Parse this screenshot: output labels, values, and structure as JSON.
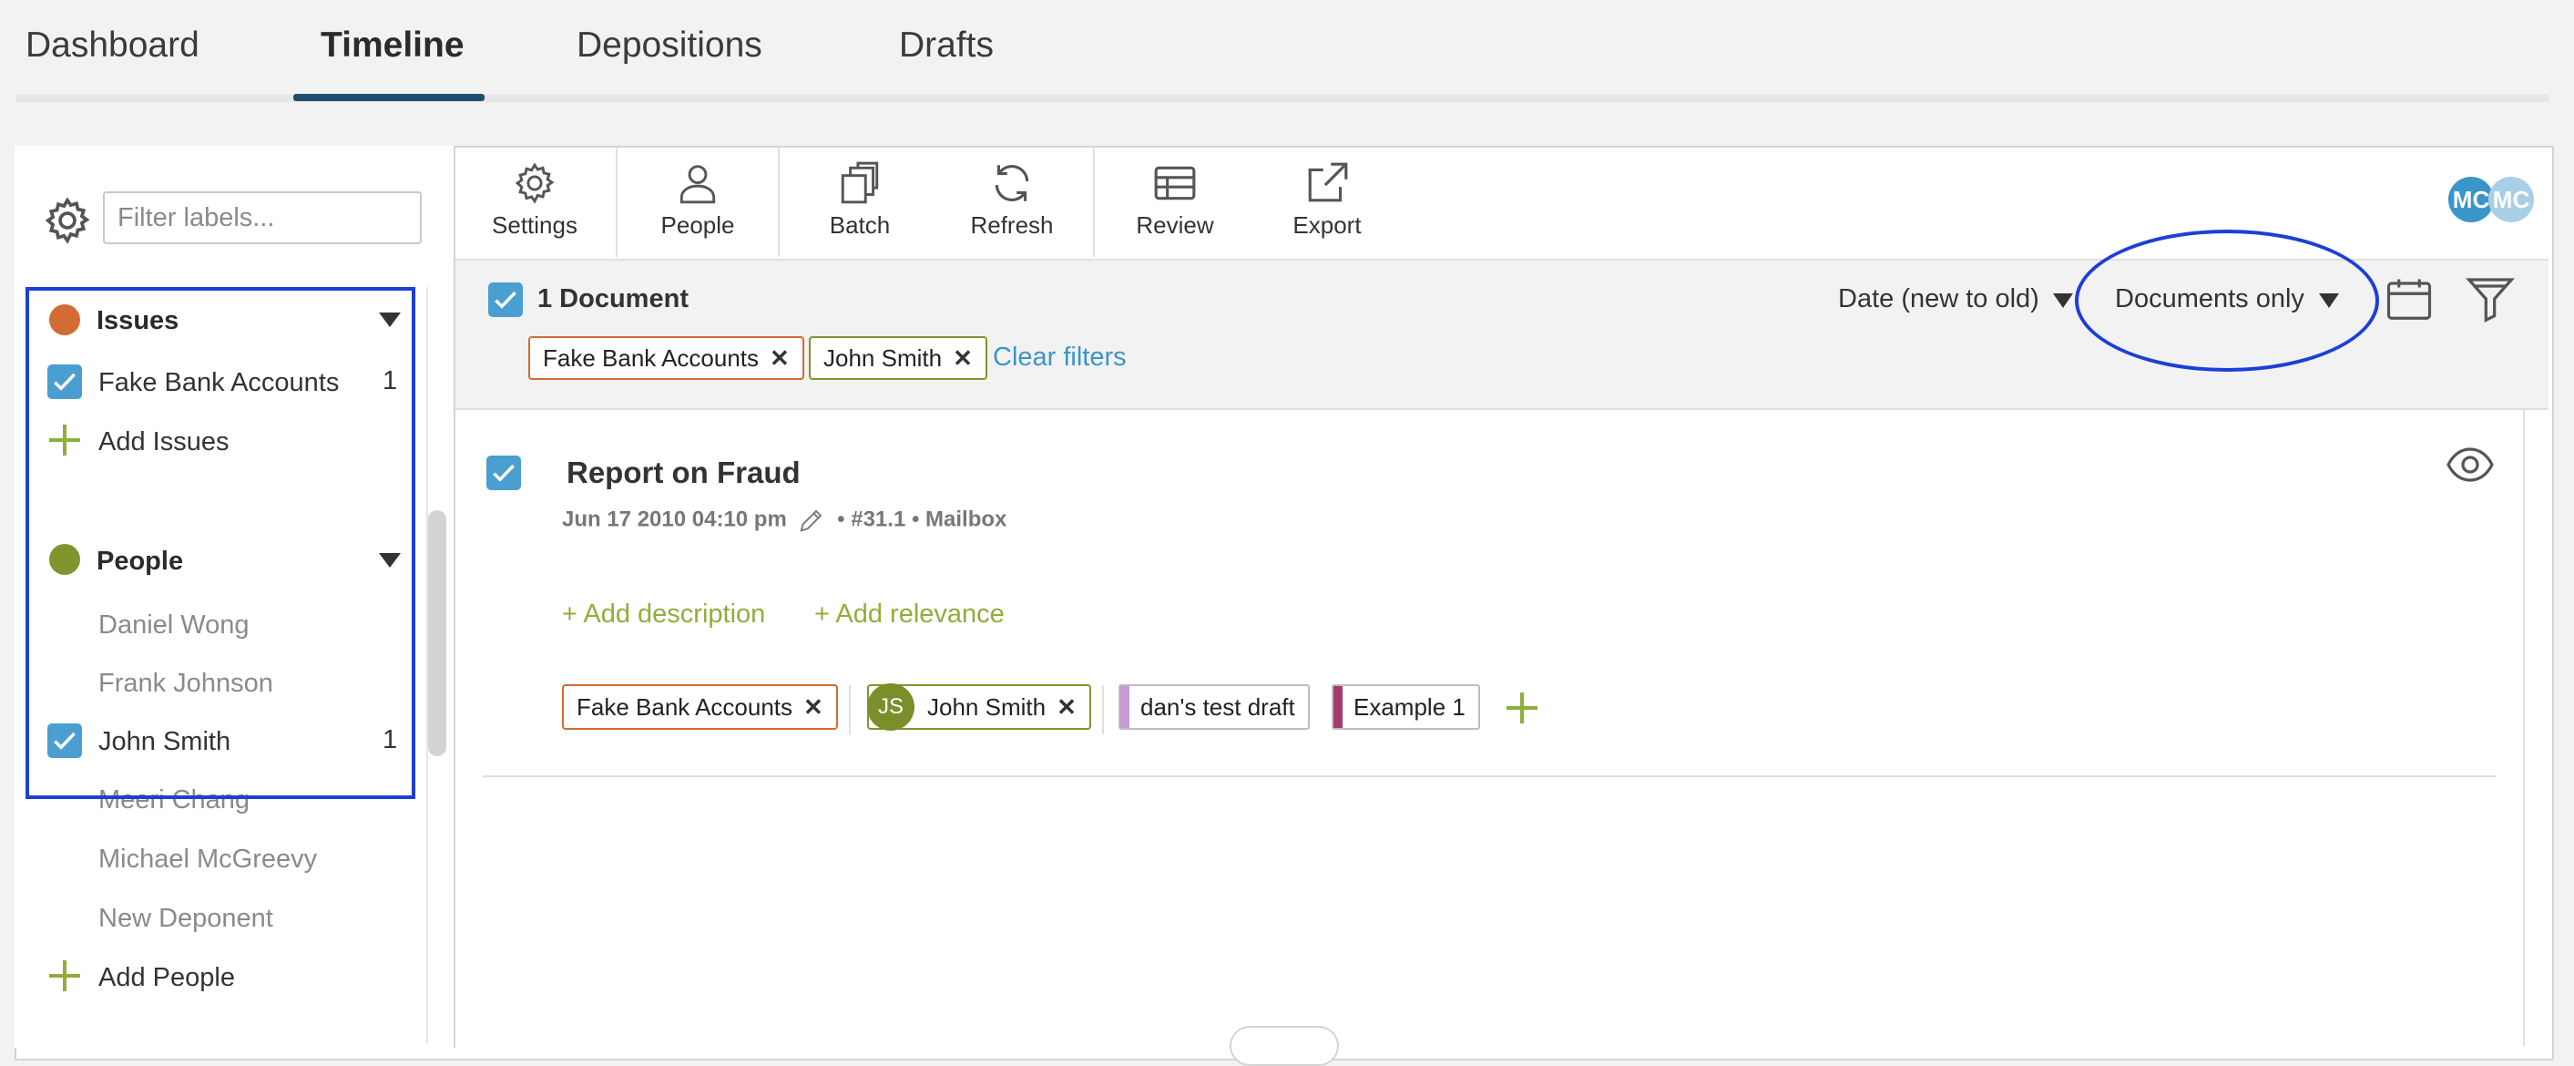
{
  "nav": {
    "tabs": [
      {
        "label": "Dashboard",
        "active": false
      },
      {
        "label": "Timeline",
        "active": true
      },
      {
        "label": "Depositions",
        "active": false
      },
      {
        "label": "Drafts",
        "active": false
      }
    ]
  },
  "sidebar": {
    "filter_placeholder": "Filter labels...",
    "issues": {
      "title": "Issues",
      "color": "#d36b33",
      "items": [
        {
          "label": "Fake Bank Accounts",
          "count": "1",
          "checked": true
        }
      ],
      "add_label": "Add Issues"
    },
    "people": {
      "title": "People",
      "color": "#7f952e",
      "items": [
        {
          "label": "Daniel Wong",
          "checked": false
        },
        {
          "label": "Frank Johnson",
          "checked": false
        },
        {
          "label": "John Smith",
          "count": "1",
          "checked": true
        },
        {
          "label": "Meeri Chang",
          "checked": false
        },
        {
          "label": "Michael McGreevy",
          "checked": false
        },
        {
          "label": "New Deponent",
          "checked": false
        }
      ],
      "add_label": "Add People"
    }
  },
  "toolbar": {
    "buttons": [
      {
        "label": "Settings",
        "icon": "gear-icon"
      },
      {
        "label": "People",
        "icon": "person-icon"
      },
      {
        "label": "Batch",
        "icon": "copy-icon"
      },
      {
        "label": "Refresh",
        "icon": "refresh-icon"
      },
      {
        "label": "Review",
        "icon": "table-icon"
      },
      {
        "label": "Export",
        "icon": "export-icon"
      }
    ],
    "avatars": [
      {
        "initials": "MC",
        "color": "#3a95c8"
      },
      {
        "initials": "MC",
        "color": "#a9cfe6"
      }
    ]
  },
  "filterbar": {
    "doc_count": "1 Document",
    "active_filters": [
      {
        "label": "Fake Bank Accounts",
        "color": "#d36b33"
      },
      {
        "label": "John Smith",
        "color": "#7f952e"
      }
    ],
    "clear_label": "Clear filters",
    "sort_label": "Date (new to old)",
    "view_label": "Documents only"
  },
  "document": {
    "title": "Report on Fraud",
    "meta_date": "Jun 17 2010 04:10 pm",
    "meta_rest": "• #31.1 • Mailbox",
    "add_description": "+ Add description",
    "add_relevance": "+ Add relevance",
    "tags": {
      "issue": {
        "label": "Fake Bank Accounts",
        "color": "#d36b33"
      },
      "person": {
        "label": "John Smith",
        "initials": "JS",
        "color": "#7f952e"
      },
      "drafts": [
        {
          "label": "dan's test draft",
          "color": "#c99bd6"
        },
        {
          "label": "Example 1",
          "color": "#a23b6e"
        }
      ]
    }
  },
  "accent_color": "#4a9fd0",
  "annotation_color": "#1c3fd8"
}
